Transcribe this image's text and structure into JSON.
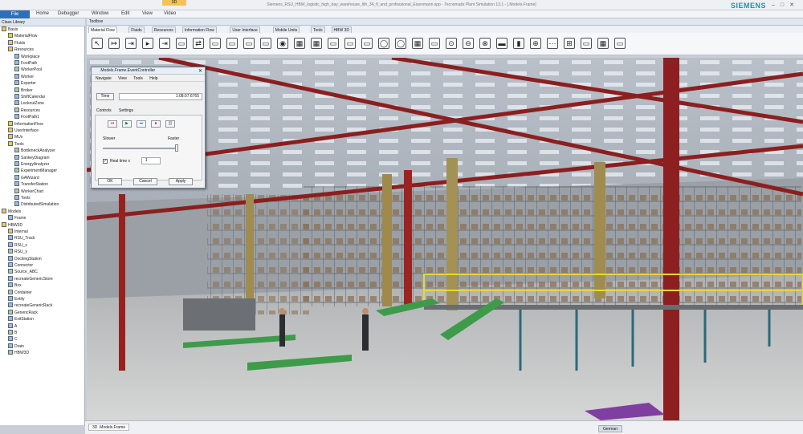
{
  "window": {
    "title": "Siemens_RSU_HBW_logistic_high_bay_warehouse_lith_34_fl_and_professional_Eisenmann.spp - Tecnomatix Plant Simulation 13.1 - [.Models.Frame]",
    "quick_tab": "3D",
    "brand": "SIEMENS",
    "controls": "–□✕"
  },
  "menu": [
    "File",
    "Home",
    "Debugger",
    "Window",
    "Edit",
    "View",
    "Video"
  ],
  "class_library": {
    "title": "Class Library",
    "items": [
      {
        "label": "Basis",
        "lvl": 0,
        "icon": "folder"
      },
      {
        "label": "MaterialFlow",
        "lvl": 1,
        "icon": "folder"
      },
      {
        "label": "Fluids",
        "lvl": 1,
        "icon": "folder"
      },
      {
        "label": "Resources",
        "lvl": 1,
        "icon": "folder"
      },
      {
        "label": "Workplace",
        "lvl": 2,
        "icon": "obj"
      },
      {
        "label": "FootPath",
        "lvl": 2,
        "icon": "obj"
      },
      {
        "label": "WorkerPool",
        "lvl": 2,
        "icon": "obj"
      },
      {
        "label": "Worker",
        "lvl": 2,
        "icon": "obj"
      },
      {
        "label": "Exporter",
        "lvl": 2,
        "icon": "obj"
      },
      {
        "label": "Broker",
        "lvl": 2,
        "icon": "obj"
      },
      {
        "label": "ShiftCalendar",
        "lvl": 2,
        "icon": "obj"
      },
      {
        "label": "LockoutZone",
        "lvl": 2,
        "icon": "obj"
      },
      {
        "label": "Resources",
        "lvl": 2,
        "icon": "obj"
      },
      {
        "label": "FootPath1",
        "lvl": 2,
        "icon": "obj"
      },
      {
        "label": "InformationFlow",
        "lvl": 1,
        "icon": "folder"
      },
      {
        "label": "UserInterface",
        "lvl": 1,
        "icon": "folder"
      },
      {
        "label": "MUs",
        "lvl": 1,
        "icon": "folder"
      },
      {
        "label": "Tools",
        "lvl": 1,
        "icon": "folder"
      },
      {
        "label": "BottleneckAnalyzer",
        "lvl": 2,
        "icon": "obj"
      },
      {
        "label": "SankeyDiagram",
        "lvl": 2,
        "icon": "obj"
      },
      {
        "label": "EnergyAnalyzer",
        "lvl": 2,
        "icon": "obj"
      },
      {
        "label": "ExperimentManager",
        "lvl": 2,
        "icon": "obj"
      },
      {
        "label": "GAWizard",
        "lvl": 2,
        "icon": "obj"
      },
      {
        "label": "TransferStation",
        "lvl": 2,
        "icon": "obj"
      },
      {
        "label": "WorkerChart",
        "lvl": 2,
        "icon": "obj"
      },
      {
        "label": "Tools",
        "lvl": 2,
        "icon": "obj"
      },
      {
        "label": "DistributedSimulation",
        "lvl": 2,
        "icon": "obj"
      },
      {
        "label": "Models",
        "lvl": 0,
        "icon": "folder"
      },
      {
        "label": "Frame",
        "lvl": 1,
        "icon": "obj"
      },
      {
        "label": "HBW3D",
        "lvl": 0,
        "icon": "folder"
      },
      {
        "label": "Internal",
        "lvl": 1,
        "icon": "folder"
      },
      {
        "label": "RSU_Track",
        "lvl": 1,
        "icon": "obj"
      },
      {
        "label": "RSU_x",
        "lvl": 1,
        "icon": "obj"
      },
      {
        "label": "RSU_y",
        "lvl": 1,
        "icon": "obj"
      },
      {
        "label": "DockingStation",
        "lvl": 1,
        "icon": "obj"
      },
      {
        "label": "Connector",
        "lvl": 1,
        "icon": "obj"
      },
      {
        "label": "Source_ABC",
        "lvl": 1,
        "icon": "obj"
      },
      {
        "label": "recreateGenericStore",
        "lvl": 1,
        "icon": "obj"
      },
      {
        "label": "Box",
        "lvl": 1,
        "icon": "obj"
      },
      {
        "label": "Container",
        "lvl": 1,
        "icon": "obj"
      },
      {
        "label": "Entity",
        "lvl": 1,
        "icon": "obj"
      },
      {
        "label": "recreateGenericRack",
        "lvl": 1,
        "icon": "obj"
      },
      {
        "label": "GenericRack",
        "lvl": 1,
        "icon": "obj"
      },
      {
        "label": "ExitStation",
        "lvl": 1,
        "icon": "obj"
      },
      {
        "label": "A",
        "lvl": 1,
        "icon": "obj"
      },
      {
        "label": "B",
        "lvl": 1,
        "icon": "obj"
      },
      {
        "label": "C",
        "lvl": 1,
        "icon": "obj"
      },
      {
        "label": "Drain",
        "lvl": 1,
        "icon": "obj"
      },
      {
        "label": "HBW3D",
        "lvl": 1,
        "icon": "obj"
      }
    ]
  },
  "toolbox": {
    "title": "Toolbox",
    "tabs": [
      "Material Flow",
      "Fluids",
      "Resources",
      "Information Flow",
      "User Interface",
      "Mobile Units",
      "Tools",
      "HBW 3D"
    ],
    "active_tab": "Material Flow"
  },
  "event_controller": {
    "title": ".Models.Frame.EventController",
    "menu": [
      "Navigate",
      "View",
      "Tools",
      "Help"
    ],
    "time_label": "Time",
    "time_value": "1:08:07.6765",
    "tabs": [
      "Controls",
      "Settings"
    ],
    "slower": "Slower",
    "faster": "Faster",
    "realtime_label": "Real time x",
    "realtime_value": "1",
    "buttons": [
      "OK",
      "Cancel",
      "Apply"
    ]
  },
  "bottom_tab": "3D .Models.Frame",
  "status_button": "German"
}
